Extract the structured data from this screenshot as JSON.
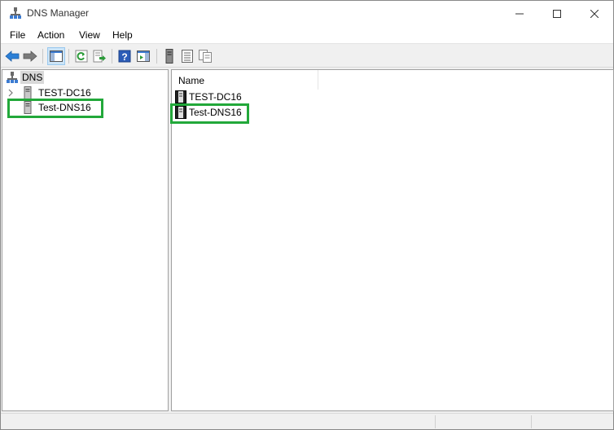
{
  "window": {
    "title": "DNS Manager"
  },
  "menu": [
    "File",
    "Action",
    "View",
    "Help"
  ],
  "tree": {
    "root": {
      "label": "DNS",
      "icon": "dns-root-icon"
    },
    "children": [
      {
        "label": "TEST-DC16",
        "icon": "server-icon",
        "expandable": true
      },
      {
        "label": "Test-DNS16",
        "icon": "server-icon",
        "expandable": false
      }
    ]
  },
  "list": {
    "columns": [
      "Name"
    ],
    "rows": [
      {
        "label": "TEST-DC16",
        "icon": "server-icon"
      },
      {
        "label": "Test-DNS16",
        "icon": "server-icon"
      }
    ]
  },
  "colors": {
    "highlight": "#22a83a",
    "selection": "#d9d9d9",
    "accent": "#1e6fc9"
  }
}
